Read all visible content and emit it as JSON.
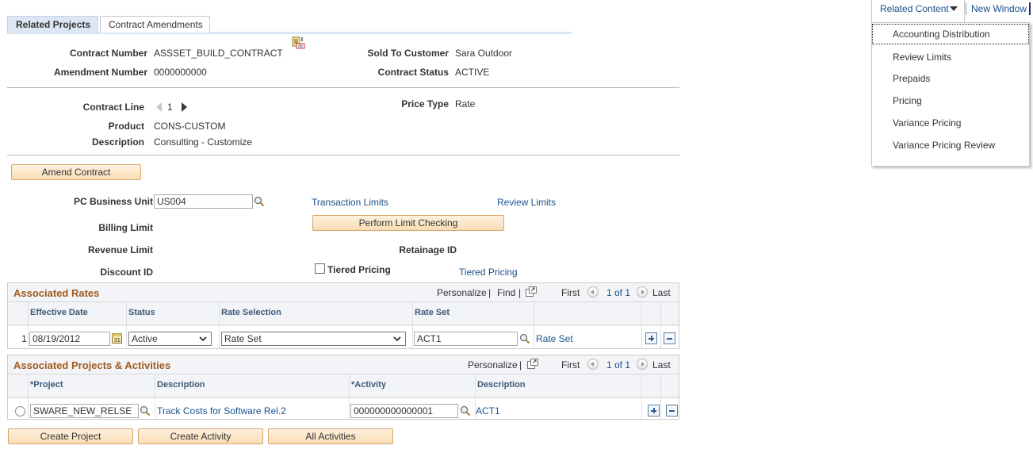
{
  "tabs": [
    {
      "label": "Related Projects",
      "active": true
    },
    {
      "label": "Contract Amendments",
      "active": false
    }
  ],
  "header": {
    "contract_number_label": "Contract Number",
    "contract_number": "ASSSET_BUILD_CONTRACT",
    "amendment_number_label": "Amendment Number",
    "amendment_number": "0000000000",
    "sold_to_label": "Sold To Customer",
    "sold_to": "Sara Outdoor",
    "contract_status_label": "Contract Status",
    "contract_status": "ACTIVE"
  },
  "line": {
    "contract_line_label": "Contract Line",
    "contract_line": "1",
    "price_type_label": "Price Type",
    "price_type": "Rate",
    "product_label": "Product",
    "product": "CONS-CUSTOM",
    "description_label": "Description",
    "description": "Consulting - Customize"
  },
  "amend_button": "Amend Contract",
  "limits": {
    "pc_bu_label": "PC Business Unit",
    "pc_bu_value": "US004",
    "transaction_limits_link": "Transaction Limits",
    "review_limits_link": "Review Limits",
    "billing_limit_label": "Billing Limit",
    "perform_limit_button": "Perform Limit Checking",
    "revenue_limit_label": "Revenue Limit",
    "retainage_label": "Retainage ID",
    "discount_label": "Discount ID",
    "tiered_checkbox_label": "Tiered Pricing",
    "tiered_checked": false,
    "tiered_link": "Tiered Pricing"
  },
  "rates_grid": {
    "title": "Associated Rates",
    "personalize": "Personalize",
    "find": "Find",
    "first": "First",
    "page_info": "1 of 1",
    "last": "Last",
    "columns": [
      "Effective Date",
      "Status",
      "Rate Selection",
      "Rate Set"
    ],
    "rows": [
      {
        "num": "1",
        "effective_date": "08/19/2012",
        "status": "Active",
        "rate_selection": "Rate Set",
        "rate_set": "ACT1",
        "rate_set_link": "Rate Set"
      }
    ]
  },
  "projects_grid": {
    "title": "Associated Projects & Activities",
    "personalize": "Personalize",
    "first": "First",
    "page_info": "1 of 1",
    "last": "Last",
    "columns": [
      "*Project",
      "Description",
      "*Activity",
      "Description"
    ],
    "rows": [
      {
        "project": "SWARE_NEW_RELSE",
        "project_desc": "Track Costs for Software Rel.2",
        "activity": "000000000000001",
        "activity_desc": "ACT1"
      }
    ]
  },
  "bottom_buttons": [
    "Create Project",
    "Create Activity",
    "All Activities"
  ],
  "related_content": {
    "label": "Related Content",
    "new_window": "New Window",
    "items": [
      "Accounting Distribution",
      "Review Limits",
      "Prepaids",
      "Pricing",
      "Variance Pricing",
      "Variance Pricing Review"
    ]
  }
}
